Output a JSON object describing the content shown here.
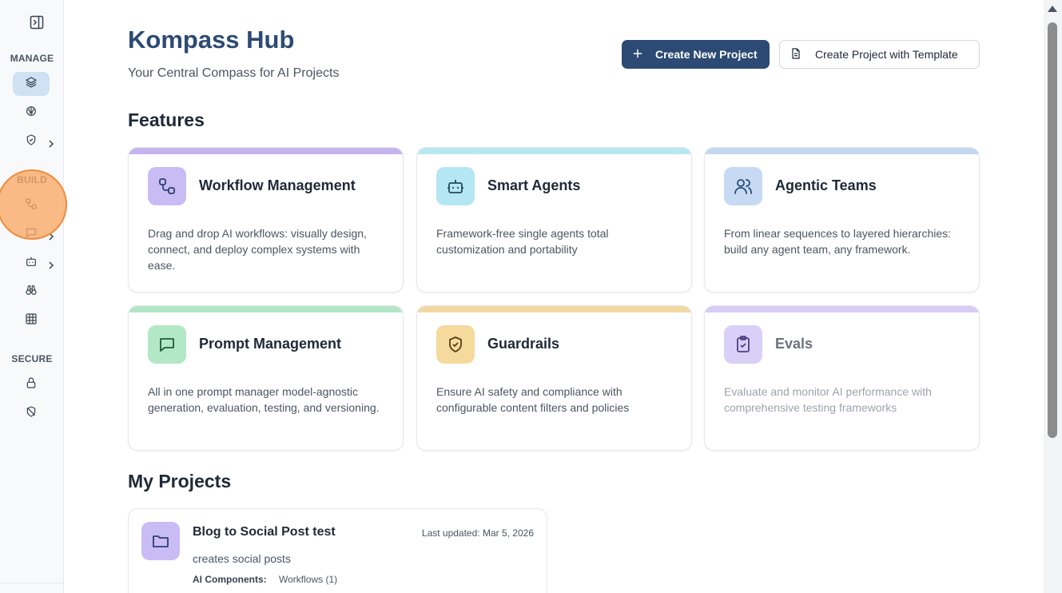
{
  "sidebar": {
    "sections": {
      "manage": "MANAGE",
      "build": "BUILD",
      "secure": "SECURE"
    },
    "icons": {
      "toggle": "sidebar-toggle-icon",
      "manage": [
        "layers-icon",
        "brain-icon",
        "shield-check-icon"
      ],
      "build": [
        "workflow-icon",
        "message-square-icon",
        "bot-icon",
        "binoculars-icon",
        "grid-table-icon"
      ],
      "secure": [
        "lock-icon",
        "shield-off-icon"
      ]
    },
    "active_item": "layers-icon",
    "highlight_color": "#f08a3c"
  },
  "header": {
    "title": "Kompass Hub",
    "subtitle": "Your Central Compass for AI Projects",
    "primary_button": "Create New Project",
    "secondary_button": "Create Project with Template",
    "primary_color": "#2c4a74"
  },
  "features": {
    "heading": "Features",
    "cards": [
      {
        "title": "Workflow Management",
        "description": "Drag and drop AI workflows: visually design, connect, and deploy complex systems with ease.",
        "icon": "workflow-icon",
        "accent": "#c4b5f0",
        "icon_bg": "#c9bcf5"
      },
      {
        "title": "Smart Agents",
        "description": "Framework-free single agents total customization and portability",
        "icon": "bot-icon",
        "accent": "#b8e8f2",
        "icon_bg": "#b5e6f3"
      },
      {
        "title": "Agentic Teams",
        "description": "From linear sequences to layered hierarchies: build any agent team, any framework.",
        "icon": "users-icon",
        "accent": "#c5d7f0",
        "icon_bg": "#c7daf4"
      },
      {
        "title": "Prompt Management",
        "description": "All in one prompt manager model-agnostic generation, evaluation, testing, and versioning.",
        "icon": "message-square-icon",
        "accent": "#b4e6c6",
        "icon_bg": "#b2e8c5"
      },
      {
        "title": "Guardrails",
        "description": "Ensure AI safety and compliance with configurable content filters and policies",
        "icon": "shield-check-icon",
        "accent": "#f2d9a4",
        "icon_bg": "#f5da9e"
      },
      {
        "title": "Evals",
        "description": "Evaluate and monitor AI performance with comprehensive testing frameworks",
        "icon": "clipboard-check-icon",
        "accent": "#d6ccf5",
        "icon_bg": "#d9d0f7",
        "muted": true
      }
    ]
  },
  "projects": {
    "heading": "My Projects",
    "items": [
      {
        "name": "Blog to Social Post test",
        "updated": "Last updated: Mar 5, 2026",
        "description": "creates social posts",
        "components_label": "AI Components:",
        "components_value": "Workflows (1)",
        "icon": "folder-icon"
      }
    ]
  }
}
